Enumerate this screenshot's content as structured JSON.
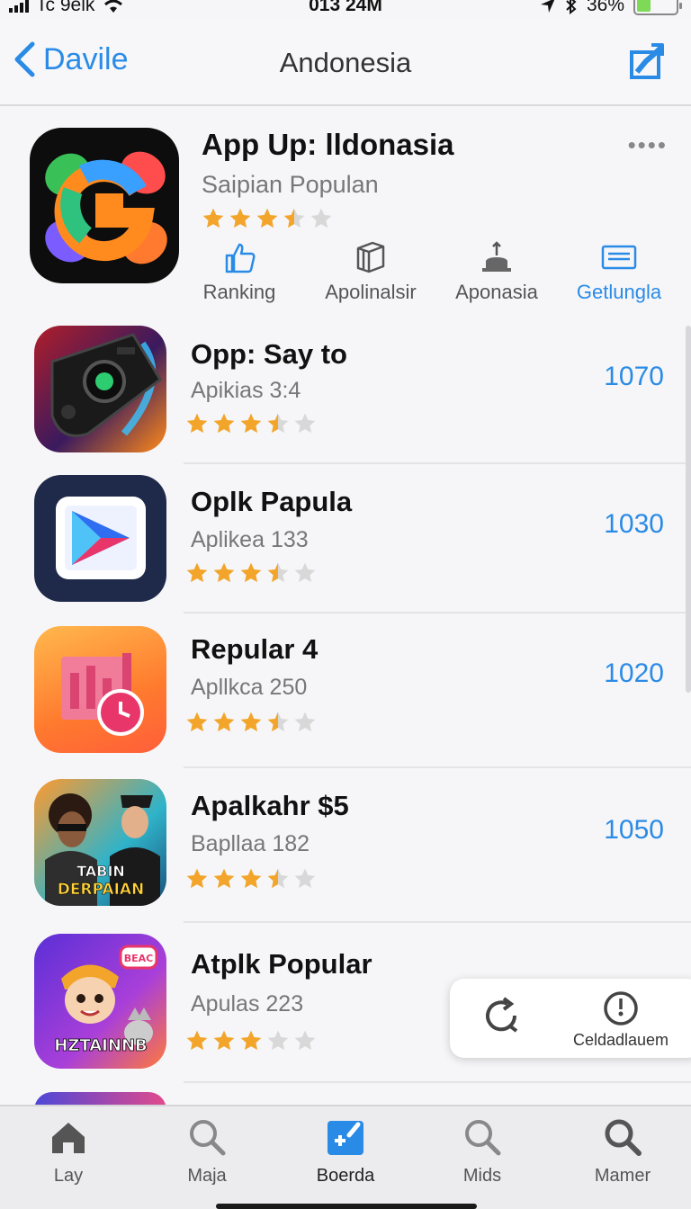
{
  "status_bar": {
    "carrier": "Tc 9elk",
    "time": "013 24M",
    "battery": "36%",
    "battery_level": 0.36
  },
  "nav": {
    "back_label": "Davile",
    "title": "Andonesia"
  },
  "featured": {
    "title": "App Up: lldonasia",
    "subtitle": "Saipian Populan",
    "rating": 3.5,
    "more_label": "••••",
    "actions": [
      {
        "label": "Ranking",
        "icon": "thumbs-up-icon"
      },
      {
        "label": "Apolinalsir",
        "icon": "box-icon"
      },
      {
        "label": "Aponasia",
        "icon": "upload-tray-icon"
      },
      {
        "label": "Getlungla",
        "icon": "list-card-icon"
      }
    ]
  },
  "apps": [
    {
      "name": "Opp: Say to",
      "subtitle": "Apikias 3:4",
      "count": "1070",
      "rating": 3.5,
      "icon": "game-controller-icon"
    },
    {
      "name": "Oplk Papula",
      "subtitle": "Aplikea 133",
      "count": "1030",
      "rating": 3.5,
      "icon": "play-store-icon"
    },
    {
      "name": "Repular 4",
      "subtitle": "Apllkca 250",
      "count": "1020",
      "rating": 3.5,
      "icon": "calendar-clock-icon"
    },
    {
      "name": "Apalkahr $5",
      "subtitle": "Bapllaa 182",
      "count": "1050",
      "rating": 3.5,
      "icon": "game-poster-icon",
      "poster_text": "TABIN DERPAIAN"
    },
    {
      "name": "Atplk Popular",
      "subtitle": "Apulas 223",
      "count": "",
      "rating": 3,
      "icon": "cartoon-game-icon",
      "poster_text": "HZTAINNB",
      "badge_text": "BEAC"
    }
  ],
  "float_panel": {
    "timer_label": "Celdadlauem"
  },
  "tabs": [
    {
      "label": "Lay",
      "icon": "home-icon"
    },
    {
      "label": "Maja",
      "icon": "search-icon"
    },
    {
      "label": "Boerda",
      "icon": "add-board-icon"
    },
    {
      "label": "Mids",
      "icon": "search-icon"
    },
    {
      "label": "Mamer",
      "icon": "search-icon"
    }
  ],
  "colors": {
    "accent": "#2a8be6",
    "star": "#f2a52a",
    "star_empty": "#d8d8d8"
  }
}
